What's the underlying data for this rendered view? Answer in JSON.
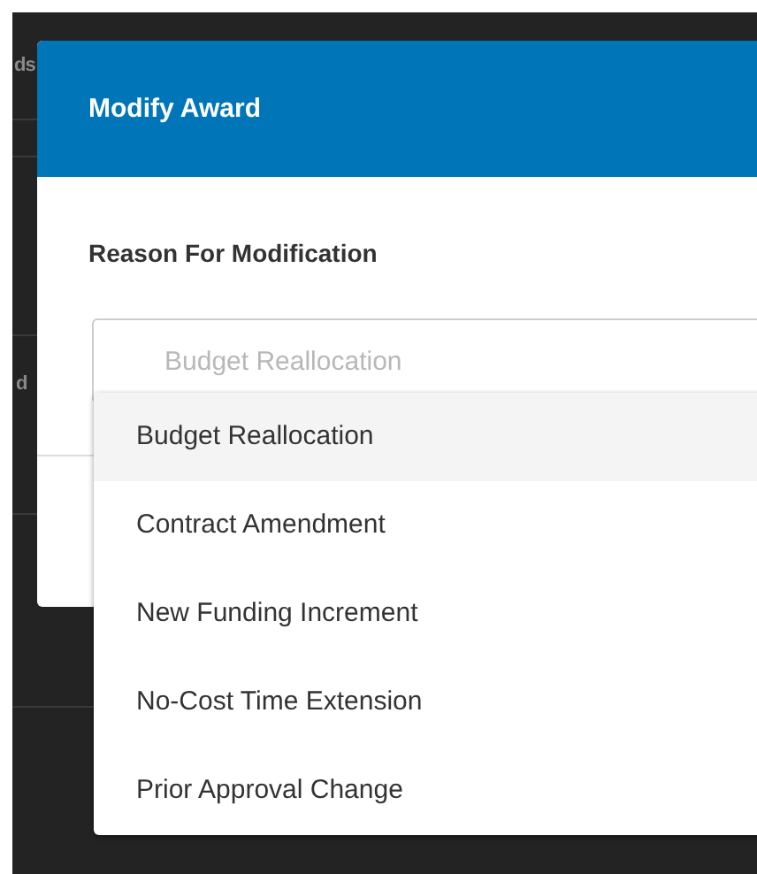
{
  "background": {
    "texts": [
      "ds",
      "d"
    ]
  },
  "dialog": {
    "title": "Modify Award",
    "field": {
      "label": "Reason For Modification",
      "placeholder": "Budget Reallocation",
      "expanded": true,
      "options": [
        {
          "label": "Budget Reallocation",
          "selected": true
        },
        {
          "label": "Contract Amendment",
          "selected": false
        },
        {
          "label": "New Funding Increment",
          "selected": false
        },
        {
          "label": "No-Cost Time Extension",
          "selected": false
        },
        {
          "label": "Prior Approval Change",
          "selected": false
        }
      ]
    }
  }
}
